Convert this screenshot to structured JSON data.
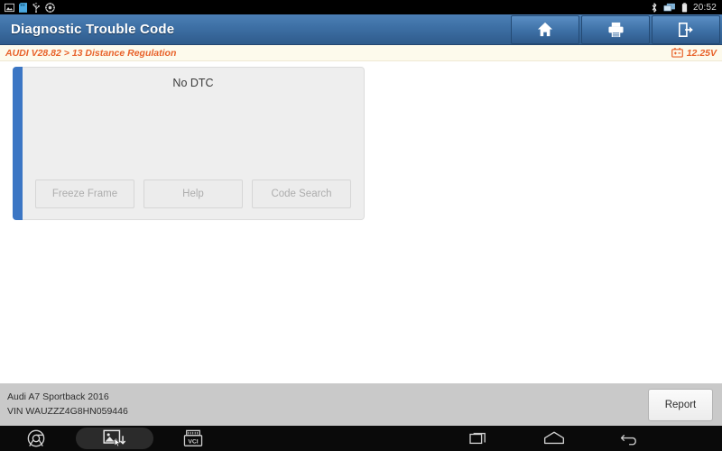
{
  "statusbar": {
    "icons": [
      {
        "name": "screenshot-icon"
      },
      {
        "name": "sd-card-icon"
      },
      {
        "name": "usb-icon"
      },
      {
        "name": "settings-icon"
      }
    ],
    "right_icons": [
      {
        "name": "bluetooth-icon"
      },
      {
        "name": "screen-cast-icon"
      },
      {
        "name": "battery-icon"
      }
    ],
    "time": "20:52"
  },
  "titlebar": {
    "title": "Diagnostic Trouble Code",
    "buttons": [
      {
        "name": "home-button",
        "icon": "home-icon"
      },
      {
        "name": "print-button",
        "icon": "printer-icon"
      },
      {
        "name": "exit-button",
        "icon": "exit-icon"
      }
    ]
  },
  "breadcrumb": {
    "path": "AUDI V28.82 > 13 Distance Regulation",
    "voltage": "12.25V",
    "voltage_icon": "battery-voltage-icon"
  },
  "dtc_panel": {
    "message": "No DTC",
    "accent_color": "#3b76c4",
    "buttons": [
      {
        "label": "Freeze Frame",
        "enabled": false
      },
      {
        "label": "Help",
        "enabled": false
      },
      {
        "label": "Code Search",
        "enabled": false
      }
    ]
  },
  "footer": {
    "vehicle": "Audi A7 Sportback 2016",
    "vin": "VIN WAUZZZ4G8HN059446",
    "report_label": "Report"
  },
  "navbar": {
    "items": [
      {
        "name": "browser-icon"
      },
      {
        "name": "screen-capture-icon"
      },
      {
        "name": "vci-icon",
        "label": "VCI"
      }
    ],
    "system": [
      {
        "name": "recents-icon"
      },
      {
        "name": "home-icon"
      },
      {
        "name": "back-icon"
      }
    ]
  }
}
